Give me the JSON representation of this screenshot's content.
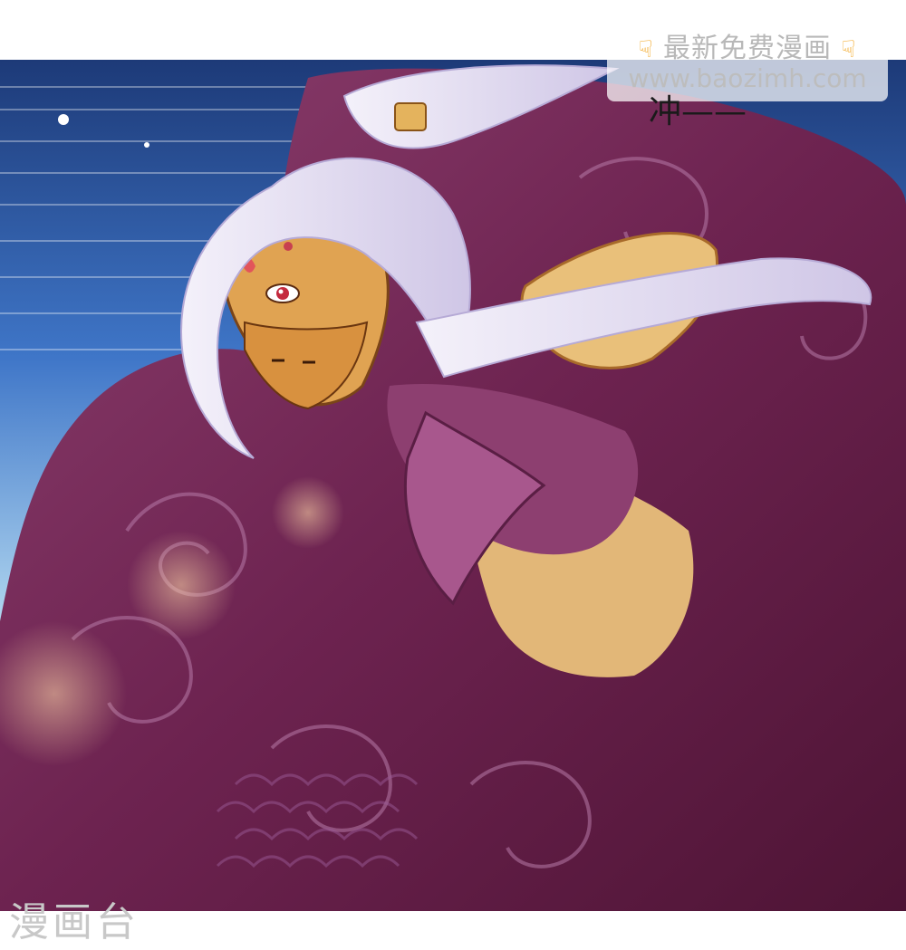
{
  "watermark": {
    "title": "最新免费漫画",
    "hand_icon": "pointing-down-hand-icon",
    "url": "www.baozimh.com"
  },
  "dialogue": {
    "sfx_text": "冲——"
  },
  "brand": {
    "logo_text": "漫画台"
  },
  "colors": {
    "sky": "#3d6fc4",
    "cape": "#7a2d5a",
    "hair": "#eeeaf6",
    "skin": "#e0a352",
    "gold": "#e7b56e"
  }
}
